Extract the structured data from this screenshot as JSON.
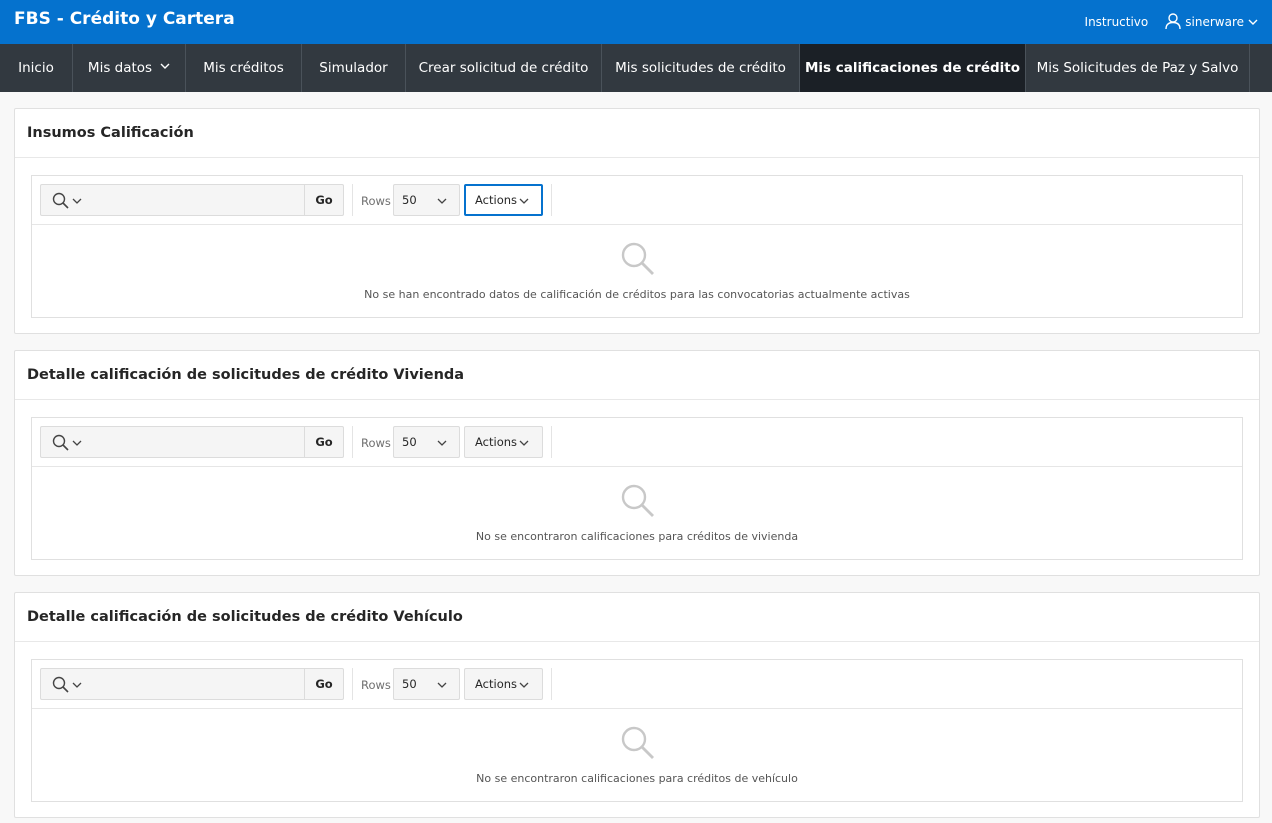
{
  "app": {
    "title": "FBS - Crédito y Cartera",
    "instructivo": "Instructivo",
    "user": "sinerware"
  },
  "nav": [
    {
      "label": "Inicio"
    },
    {
      "label": "Mis datos"
    },
    {
      "label": "Mis créditos"
    },
    {
      "label": "Simulador"
    },
    {
      "label": "Crear solicitud de crédito"
    },
    {
      "label": "Mis solicitudes de crédito"
    },
    {
      "label": "Mis calificaciones de crédito"
    },
    {
      "label": "Mis Solicitudes de Paz y Salvo"
    }
  ],
  "active_nav": "Mis calificaciones de crédito",
  "toolbar": {
    "go_label": "Go",
    "rows_label": "Rows",
    "rows_value": "50",
    "actions_label": "Actions"
  },
  "regions": [
    {
      "title": "Insumos Calificación",
      "empty_message": "No se han encontrado datos de calificación de créditos para las convocatorias actualmente activas"
    },
    {
      "title": "Detalle calificación de solicitudes de crédito Vivienda",
      "empty_message": "No se encontraron calificaciones para créditos de vivienda"
    },
    {
      "title": "Detalle calificación de solicitudes de crédito Vehículo",
      "empty_message": "No se encontraron calificaciones para créditos de vehículo"
    }
  ],
  "colors": {
    "header_bg": "#0572ce",
    "nav_bg": "#323940",
    "nav_active_bg": "#1b2026",
    "focus": "#0572ce"
  }
}
